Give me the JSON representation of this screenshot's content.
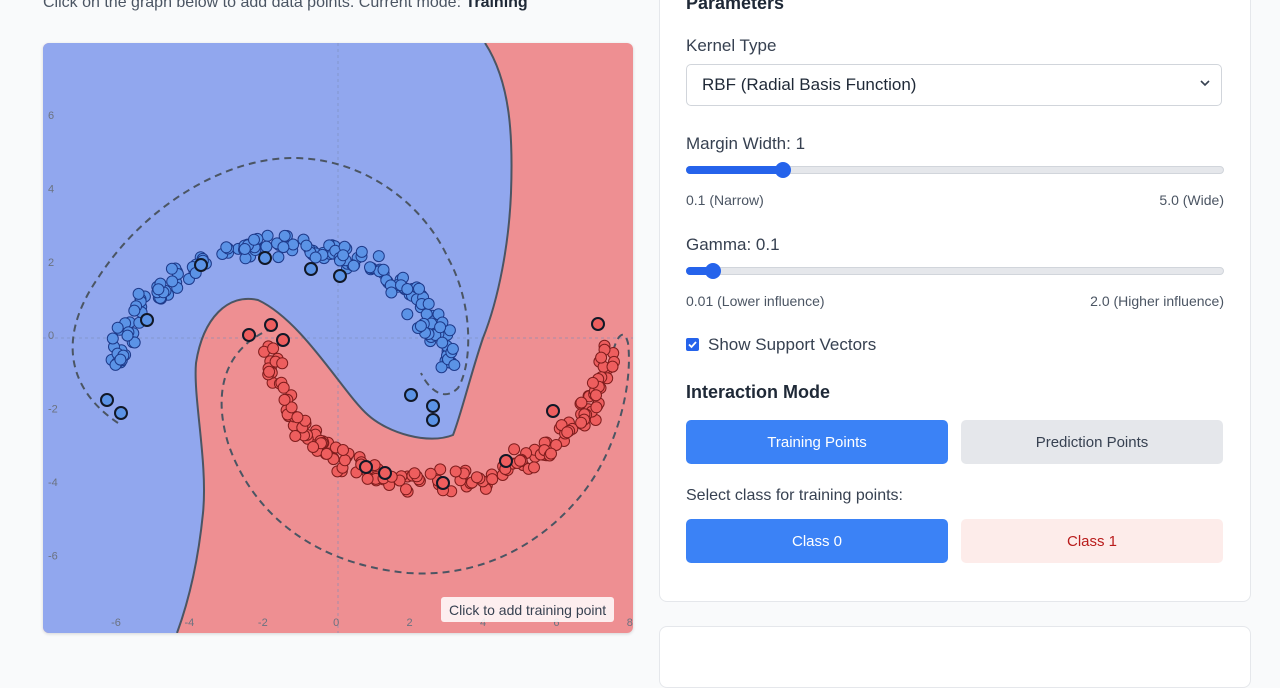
{
  "instructions": {
    "text": "Click on the graph below to add data points. Current mode: ",
    "mode": "Training"
  },
  "plot": {
    "x_ticks": [
      "-6",
      "-4",
      "-2",
      "0",
      "2",
      "4",
      "6",
      "8"
    ],
    "y_ticks": [
      "6",
      "4",
      "2",
      "0",
      "-2",
      "-4",
      "-6"
    ],
    "hint": "Click to add training point",
    "colors": {
      "class0_region": "#91a7ee",
      "class1_region": "#ee8f92",
      "class0_point": "#5b93e6",
      "class1_point": "#ee5e5e",
      "boundary": "#4b5563"
    }
  },
  "parameters": {
    "title": "Parameters",
    "kernel_label": "Kernel Type",
    "kernel_value": "RBF (Radial Basis Function)",
    "margin_label": "Margin Width: 1",
    "margin_fraction": 0.18,
    "margin_min": "0.1 (Narrow)",
    "margin_max": "5.0 (Wide)",
    "gamma_label": "Gamma: 0.1",
    "gamma_fraction": 0.05,
    "gamma_min": "0.01 (Lower influence)",
    "gamma_max": "2.0 (Higher influence)",
    "show_sv_label": "Show Support Vectors",
    "show_sv_checked": true
  },
  "interaction": {
    "title": "Interaction Mode",
    "training_btn": "Training Points",
    "prediction_btn": "Prediction Points",
    "class_prompt": "Select class for training points:",
    "class0_btn": "Class 0",
    "class1_btn": "Class 1"
  }
}
